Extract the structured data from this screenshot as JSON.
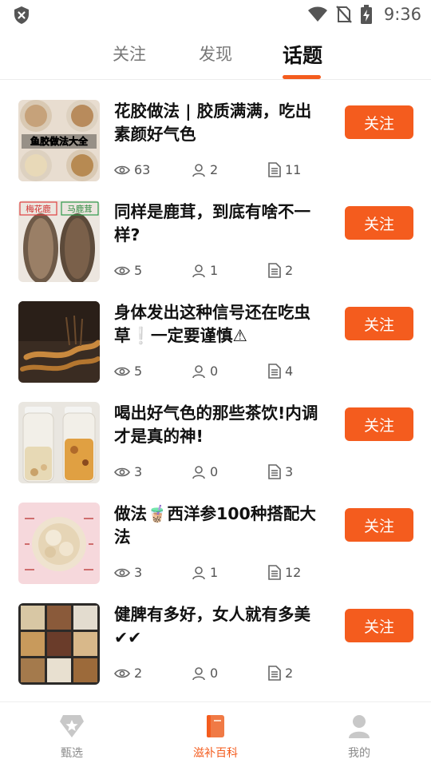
{
  "status_bar": {
    "time": "9:36"
  },
  "top_tabs": [
    {
      "label": "关注",
      "active": false
    },
    {
      "label": "发现",
      "active": false
    },
    {
      "label": "话题",
      "active": true
    }
  ],
  "topics": [
    {
      "title": "花胶做法 | 胶质满满，吃出素颜好气色",
      "thumb_caption": "鱼胶做法大全",
      "views": "63",
      "users": "2",
      "posts": "11",
      "follow_label": "关注"
    },
    {
      "title": "同样是鹿茸，到底有啥不一样?",
      "thumb_labels": [
        "梅花鹿",
        "马鹿茸"
      ],
      "views": "5",
      "users": "1",
      "posts": "2",
      "follow_label": "关注"
    },
    {
      "title": "身体发出这种信号还在吃虫草❕一定要谨慎⚠",
      "views": "5",
      "users": "0",
      "posts": "4",
      "follow_label": "关注"
    },
    {
      "title": "喝出好气色的那些茶饮!内调才是真的神!",
      "views": "3",
      "users": "0",
      "posts": "3",
      "follow_label": "关注"
    },
    {
      "title": "做法🧋西洋参100种搭配大法",
      "views": "3",
      "users": "1",
      "posts": "12",
      "follow_label": "关注"
    },
    {
      "title": "健脾有多好，女人就有多美✔✔",
      "views": "2",
      "users": "0",
      "posts": "2",
      "follow_label": "关注"
    }
  ],
  "bottom_nav": [
    {
      "label": "甄选",
      "icon": "star-shield-icon",
      "active": false
    },
    {
      "label": "滋补百科",
      "icon": "book-icon",
      "active": true
    },
    {
      "label": "我的",
      "icon": "person-icon",
      "active": false
    }
  ],
  "colors": {
    "accent": "#f45c1e",
    "text": "#111111",
    "muted": "#555555"
  }
}
